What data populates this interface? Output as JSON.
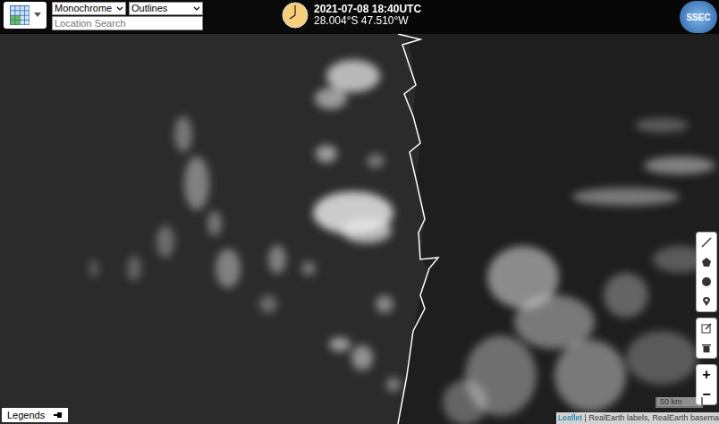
{
  "layer_control": {
    "basemap_select": "Monochrome",
    "overlay_select": "Outlines",
    "search": {
      "placeholder": "Location Search"
    }
  },
  "time_display": {
    "timestamp": "2021-07-08 18:40UTC",
    "coordinates": "28.004°S 47.510°W"
  },
  "logo": "SSEC",
  "zoom": {
    "in": "+",
    "out": "−"
  },
  "legends_button": {
    "label": "Legends"
  },
  "scale_bar": {
    "label": "50 km"
  },
  "attribution": {
    "link": "Leaflet",
    "text": " | RealEarth labels, RealEarth basema"
  }
}
